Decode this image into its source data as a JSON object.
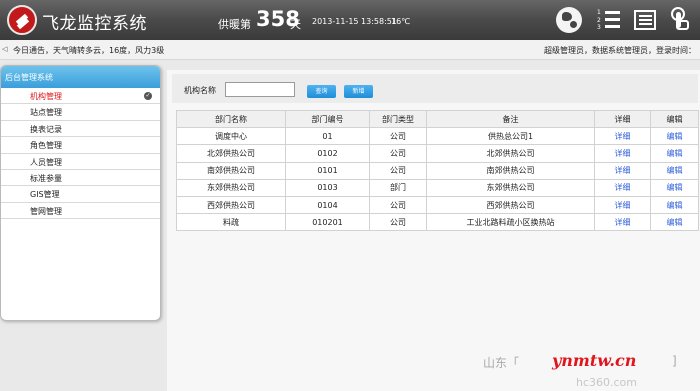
{
  "header": {
    "app_title": "飞龙监控系统",
    "heat_prefix": "供暖第",
    "heat_days": "358",
    "heat_suffix": "天",
    "datetime": "2013-11-15 13:58:51",
    "temperature": "16℃",
    "icons": [
      "globe-icon",
      "numbered-list-icon",
      "table-icon",
      "touch-icon"
    ]
  },
  "notice": {
    "text": "今日通告，天气晴转多云，16度，风力3级",
    "user_info": "超级管理员，数据系统管理员，登录时间："
  },
  "sidebar": {
    "title": "后台管理系统",
    "items": [
      {
        "label": "机构管理"
      },
      {
        "label": "站点管理"
      },
      {
        "label": "换表记录"
      },
      {
        "label": "角色管理"
      },
      {
        "label": "人员管理"
      },
      {
        "label": "标准参量"
      },
      {
        "label": "GIS管理"
      },
      {
        "label": "管网管理"
      }
    ]
  },
  "search": {
    "label": "机构名称",
    "value": "",
    "placeholder": "",
    "search_button": "查询",
    "add_button": "新增"
  },
  "table": {
    "headers": [
      "部门名称",
      "部门编号",
      "部门类型",
      "备注",
      "详细",
      "编辑"
    ],
    "rows": [
      [
        "调度中心",
        "01",
        "公司",
        "供热总公司1",
        "详细",
        "编辑"
      ],
      [
        "北郊供热公司",
        "0102",
        "公司",
        "北郊供热公司",
        "详细",
        "编辑"
      ],
      [
        "南郊供热公司",
        "0101",
        "公司",
        "南郊供热公司",
        "详细",
        "编辑"
      ],
      [
        "东郊供热公司",
        "0103",
        "部门",
        "东郊供热公司",
        "详细",
        "编辑"
      ],
      [
        "西郊供热公司",
        "0104",
        "公司",
        "西郊供热公司",
        "详细",
        "编辑"
      ],
      [
        "料疏",
        "010201",
        "公司",
        "工业北路料疏小区换热站",
        "详细",
        "编辑"
      ]
    ]
  },
  "watermark": {
    "region": "山东「",
    "brand": "ynmtw.cn",
    "bracket": "]",
    "url": "hc360.com"
  }
}
